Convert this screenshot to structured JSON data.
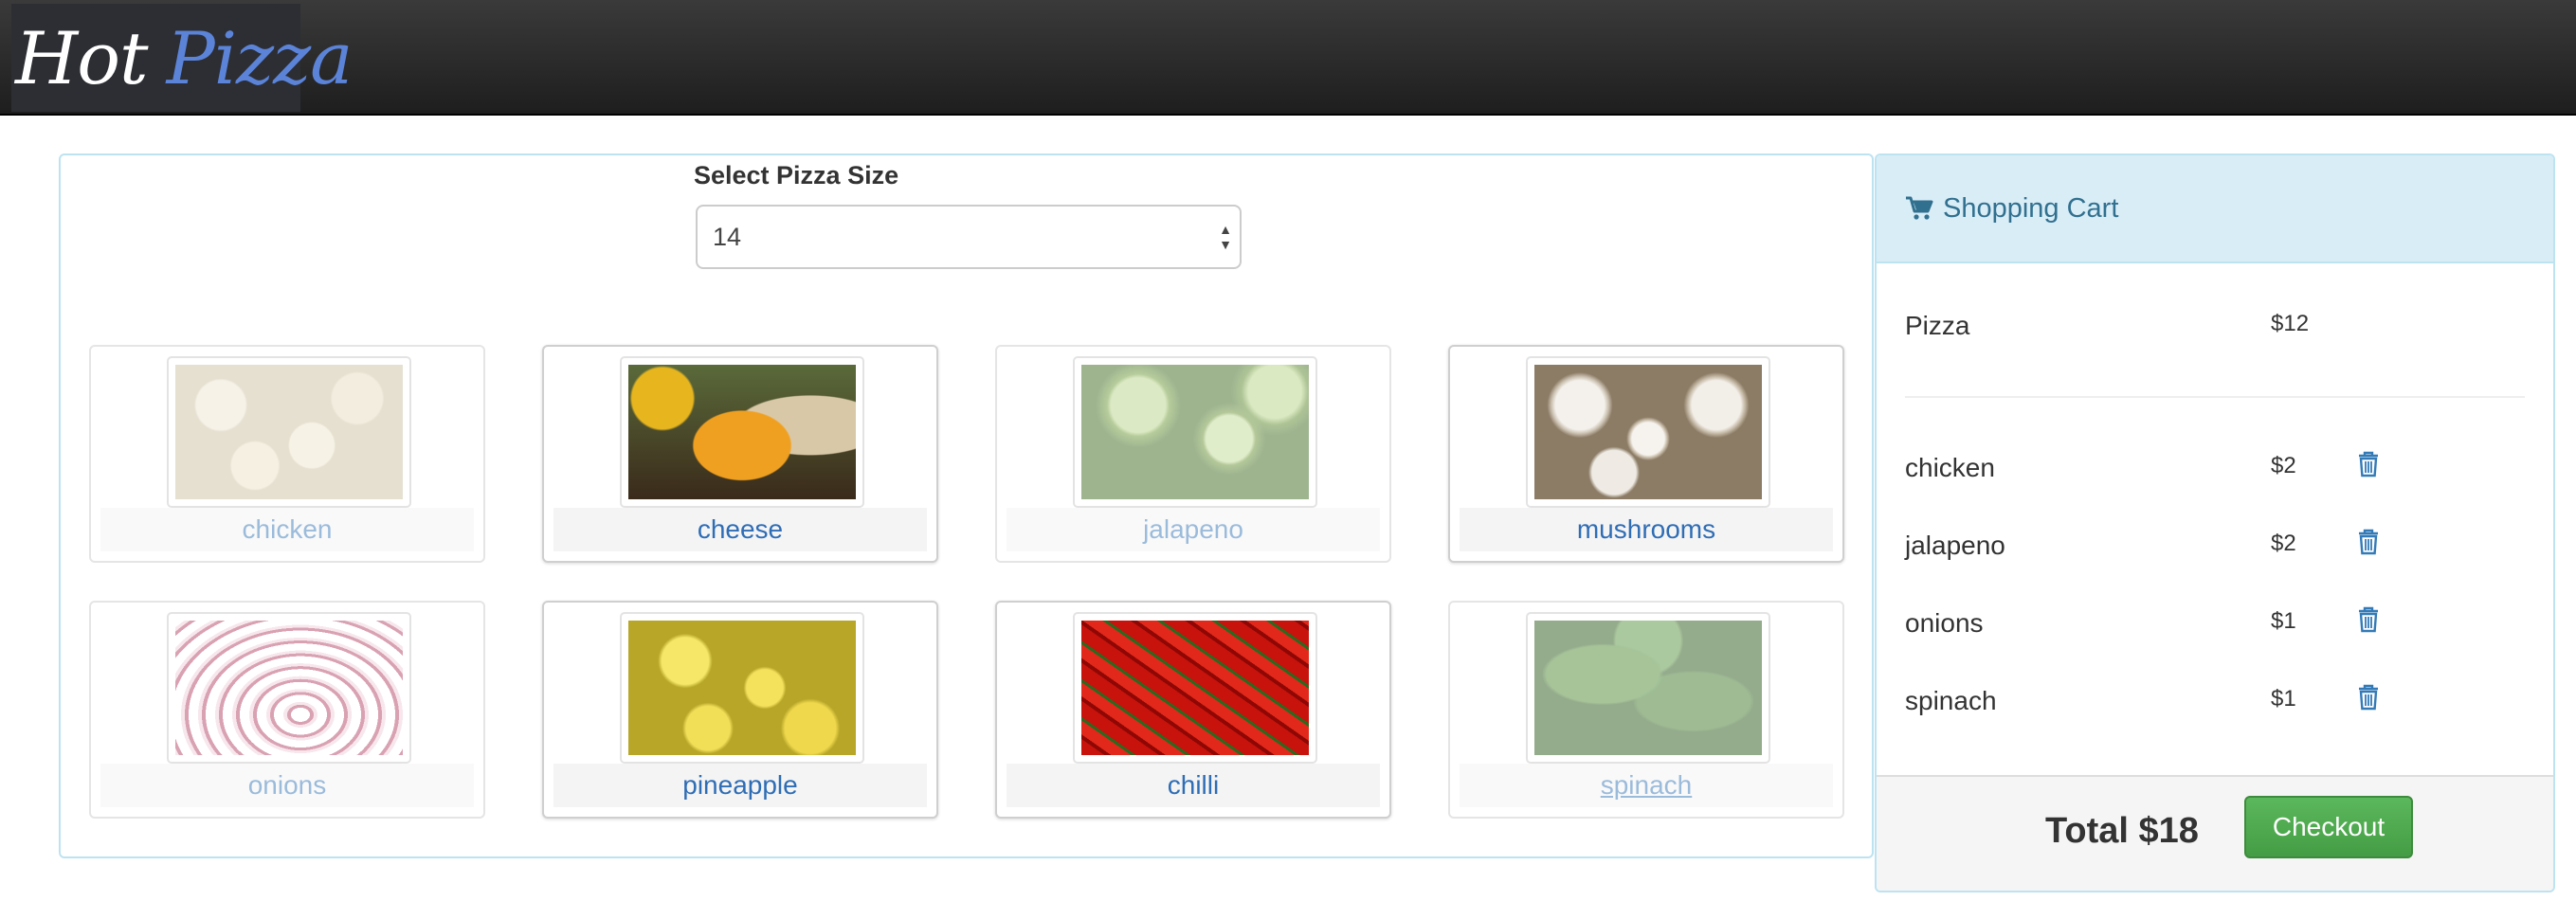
{
  "brand": {
    "word1": "Hot",
    "word2": "Pizza"
  },
  "size": {
    "label": "Select Pizza Size",
    "value": "14"
  },
  "toppings": [
    {
      "name": "chicken",
      "selected": false,
      "icon": "chicken-image"
    },
    {
      "name": "cheese",
      "selected": true,
      "icon": "cheese-image"
    },
    {
      "name": "jalapeno",
      "selected": false,
      "icon": "jalapeno-image"
    },
    {
      "name": "mushrooms",
      "selected": true,
      "icon": "mushrooms-image"
    },
    {
      "name": "onions",
      "selected": false,
      "icon": "onions-image"
    },
    {
      "name": "pineapple",
      "selected": true,
      "icon": "pineapple-image"
    },
    {
      "name": "chilli",
      "selected": true,
      "icon": "chilli-image"
    },
    {
      "name": "spinach",
      "selected": false,
      "icon": "spinach-image"
    }
  ],
  "cart": {
    "title": "Shopping Cart",
    "icon": "shopping-cart-icon",
    "base": {
      "item": "Pizza",
      "price": "$12"
    },
    "items": [
      {
        "item": "chicken",
        "price": "$2"
      },
      {
        "item": "jalapeno",
        "price": "$2"
      },
      {
        "item": "onions",
        "price": "$1"
      },
      {
        "item": "spinach",
        "price": "$1"
      }
    ],
    "total": "Total $18",
    "checkout_label": "Checkout"
  },
  "colors": {
    "accent": "#2f6db5",
    "cart_header": "#d9edf7",
    "cart_text": "#31708f",
    "checkout": "#5cb85c"
  }
}
